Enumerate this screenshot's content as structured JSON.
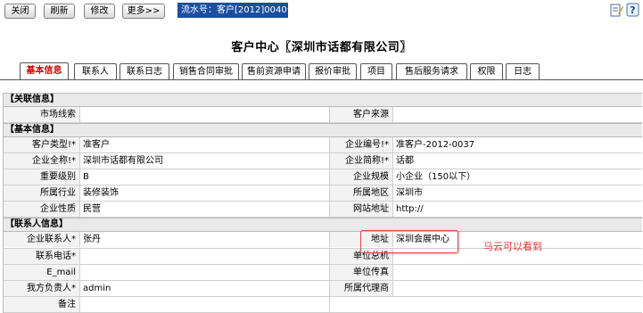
{
  "toolbar": {
    "close": "关闭",
    "refresh": "刷新",
    "edit": "修改",
    "more": "更多>>",
    "serial": "流水号：客户[2012]0040号"
  },
  "page_title": "客户中心〖深圳市话都有限公司〗",
  "tabs": [
    "基本信息",
    "联系人",
    "联系日志",
    "销售合同审批",
    "售前资源申请",
    "报价审批",
    "项目",
    "售后服务请求",
    "权限",
    "日志"
  ],
  "sections": {
    "related": "【关联信息】",
    "basic": "【基本信息】",
    "contact": "【联系人信息】"
  },
  "related": {
    "market_clue_label": "市场线索",
    "market_clue_value": "",
    "source_label": "客户来源",
    "source_value": ""
  },
  "basic": {
    "customer_type_label": "客户类型!*",
    "customer_type_value": "准客户",
    "company_no_label": "企业编号!*",
    "company_no_value": "准客户-2012-0037",
    "full_name_label": "企业全称!*",
    "full_name_value": "深圳市话都有限公司",
    "short_name_label": "企业简称!*",
    "short_name_value": "话都",
    "level_label": "重要级别",
    "level_value": "B",
    "scale_label": "企业规模",
    "scale_value": "小企业（150以下）",
    "industry_label": "所属行业",
    "industry_value": "装修装饰",
    "region_label": "所属地区",
    "region_value": "深圳市",
    "nature_label": "企业性质",
    "nature_value": "民营",
    "website_label": "网站地址",
    "website_value": "http://"
  },
  "contact": {
    "contact_person_label": "企业联系人*",
    "contact_person_value": "张丹",
    "address_label": "地址",
    "address_value": "深圳会展中心",
    "phone_label": "联系电话*",
    "phone_value": "",
    "switchboard_label": "单位总机",
    "switchboard_value": "",
    "email_label": "E_mail",
    "email_value": "",
    "fax_label": "单位传真",
    "fax_value": "",
    "owner_label": "我方负责人*",
    "owner_value": "admin",
    "agent_label": "所属代理商",
    "agent_value": "",
    "remark_label": "备注"
  },
  "annotation": "马云可以看到",
  "colors": {
    "serial_bg": "#1a4e9f",
    "active_tab": "#d40000",
    "highlight": "#e24a4a"
  }
}
